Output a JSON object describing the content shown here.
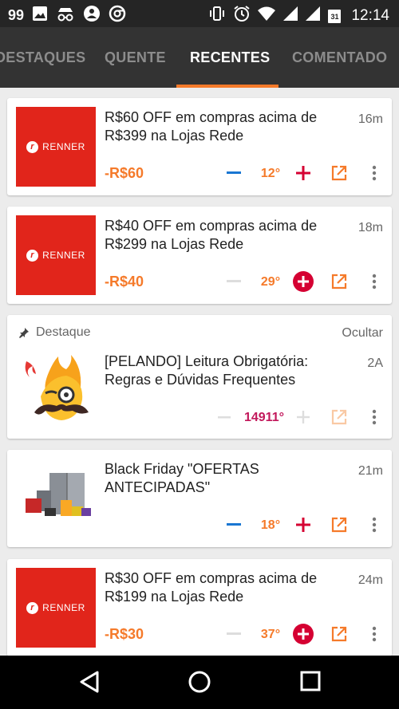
{
  "status_bar": {
    "notification_count": "99",
    "time": "12:14",
    "calendar_day": "31"
  },
  "tabs": [
    {
      "label": "DESTAQUES",
      "active": false
    },
    {
      "label": "QUENTE",
      "active": false
    },
    {
      "label": "RECENTES",
      "active": true
    },
    {
      "label": "COMENTADO",
      "active": false
    }
  ],
  "deals": [
    {
      "title": "R$60 OFF em compras acima de R$399 na Lojas Rede",
      "age": "16m",
      "price": "-R$60",
      "temperature": "12°",
      "thumb_text": "RENNER",
      "vote_up_filled": false
    },
    {
      "title": "R$40 OFF em compras acima de R$299 na Lojas Rede",
      "age": "18m",
      "price": "-R$40",
      "temperature": "29°",
      "thumb_text": "RENNER",
      "vote_up_filled": true
    },
    {
      "pinned_label": "Destaque",
      "hide_label": "Ocultar",
      "title": "[PELANDO] Leitura Obrigatória: Regras e Dúvidas Frequentes",
      "age": "2A",
      "temperature": "14911°",
      "vote_up_filled": false
    },
    {
      "title": "Black Friday   \"OFERTAS ANTECIPADAS\"",
      "age": "21m",
      "temperature": "18°",
      "vote_up_filled": false
    },
    {
      "title": "R$30 OFF em compras acima de R$199 na Lojas Rede",
      "age": "24m",
      "price": "-R$30",
      "temperature": "37°",
      "thumb_text": "RENNER",
      "vote_up_filled": true
    }
  ],
  "colors": {
    "accent": "#f57a2a",
    "vote_blue": "#1976d2",
    "vote_red": "#d50032",
    "hot_temp": "#c2185b",
    "renner_red": "#e1251b"
  },
  "icons": [
    "gallery-icon",
    "incognito-icon",
    "shield-icon",
    "chrome-icon",
    "vibrate-icon",
    "alarm-icon",
    "wifi-icon",
    "signal-icon",
    "calendar-icon",
    "pin-icon",
    "minus-icon",
    "plus-icon",
    "external-link-icon",
    "more-vert-icon",
    "back-icon",
    "home-icon",
    "recents-icon"
  ]
}
